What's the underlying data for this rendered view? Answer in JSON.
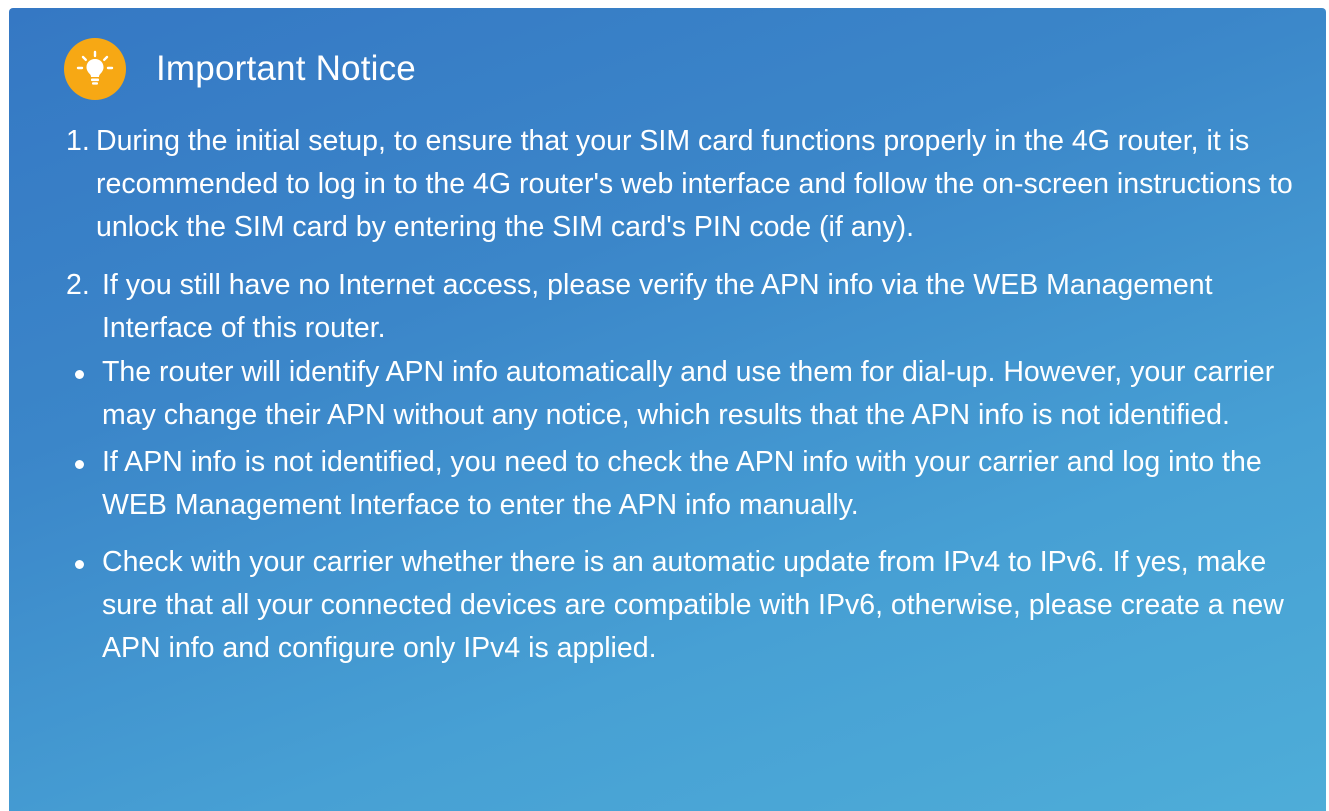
{
  "notice": {
    "title": "Important Notice",
    "icon": "lightbulb-icon",
    "icon_color": "#f7a814",
    "items": [
      {
        "number": "1.",
        "text": "During the initial setup, to ensure that your SIM card functions properly in the 4G router, it is recommended to log in to the 4G router's web interface and follow the on-screen instructions to unlock the SIM card by entering the SIM card's PIN code (if any)."
      },
      {
        "number": "2.",
        "text": "If you still have no Internet access, please verify the APN info via the WEB Management Interface of this router."
      }
    ],
    "bullets": [
      "The router will identify APN info automatically and use them for dial-up. However, your carrier may change their APN without any notice, which results that the APN info is not identified.",
      "If APN info is not identified, you need to check the APN info with your carrier and log into the WEB Management Interface to enter the APN info manually.",
      "Check with your carrier whether there is an automatic update from IPv4 to IPv6. If yes, make sure that all your connected devices are compatible with IPv6, otherwise, please create a new APN info and configure only IPv4 is applied."
    ]
  }
}
